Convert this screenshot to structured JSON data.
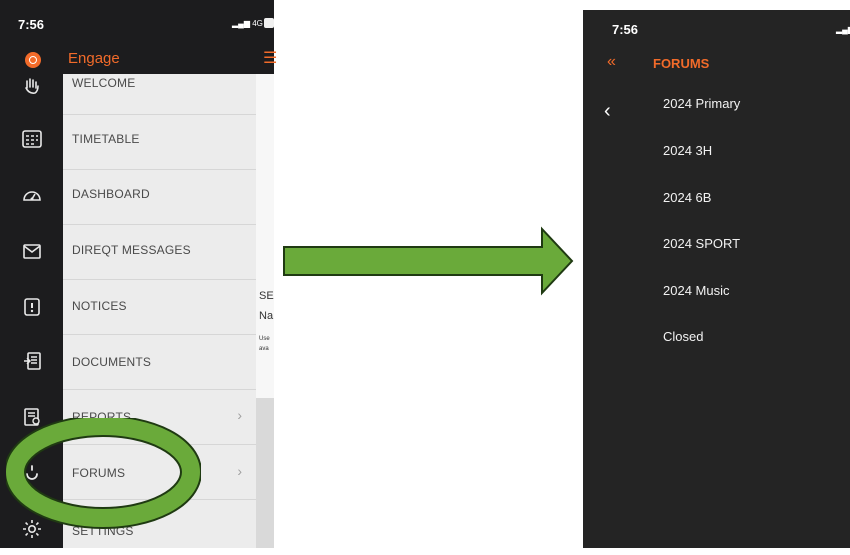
{
  "left_screen": {
    "status_time": "7:56",
    "status_signal": "▂▄▆ 4G",
    "app_title": "Engage",
    "menu_icon": "☰",
    "rail_icons": [
      "wave-icon",
      "timetable-icon",
      "dashboard-icon",
      "messages-icon",
      "notices-icon",
      "documents-icon",
      "reports-icon",
      "forums-icon",
      "settings-icon"
    ],
    "drawer_items": [
      {
        "label": "WELCOME",
        "chevron": ""
      },
      {
        "label": "TIMETABLE",
        "chevron": ""
      },
      {
        "label": "DASHBOARD",
        "chevron": ""
      },
      {
        "label": "DIREQT MESSAGES",
        "chevron": ""
      },
      {
        "label": "NOTICES",
        "chevron": ""
      },
      {
        "label": "DOCUMENTS",
        "chevron": ""
      },
      {
        "label": "REPORTS",
        "chevron": "›"
      },
      {
        "label": "FORUMS",
        "chevron": "›"
      },
      {
        "label": "SETTINGS",
        "chevron": ""
      }
    ],
    "peek": {
      "line1": "SE",
      "line2": "Na",
      "small1": "Use",
      "small2": "ava"
    }
  },
  "right_screen": {
    "status_time": "7:56",
    "status_signal": "▂▄▆",
    "back_double": "«",
    "header_title": "FORUMS",
    "back": "‹",
    "forums": [
      "2024 Primary",
      "2024 3H",
      "2024 6B",
      "2024 SPORT",
      "2024 Music",
      "Closed"
    ]
  },
  "colors": {
    "accent": "#f26b2a",
    "highlight_green": "#6aaa3a",
    "outline": "#1f3a12"
  }
}
